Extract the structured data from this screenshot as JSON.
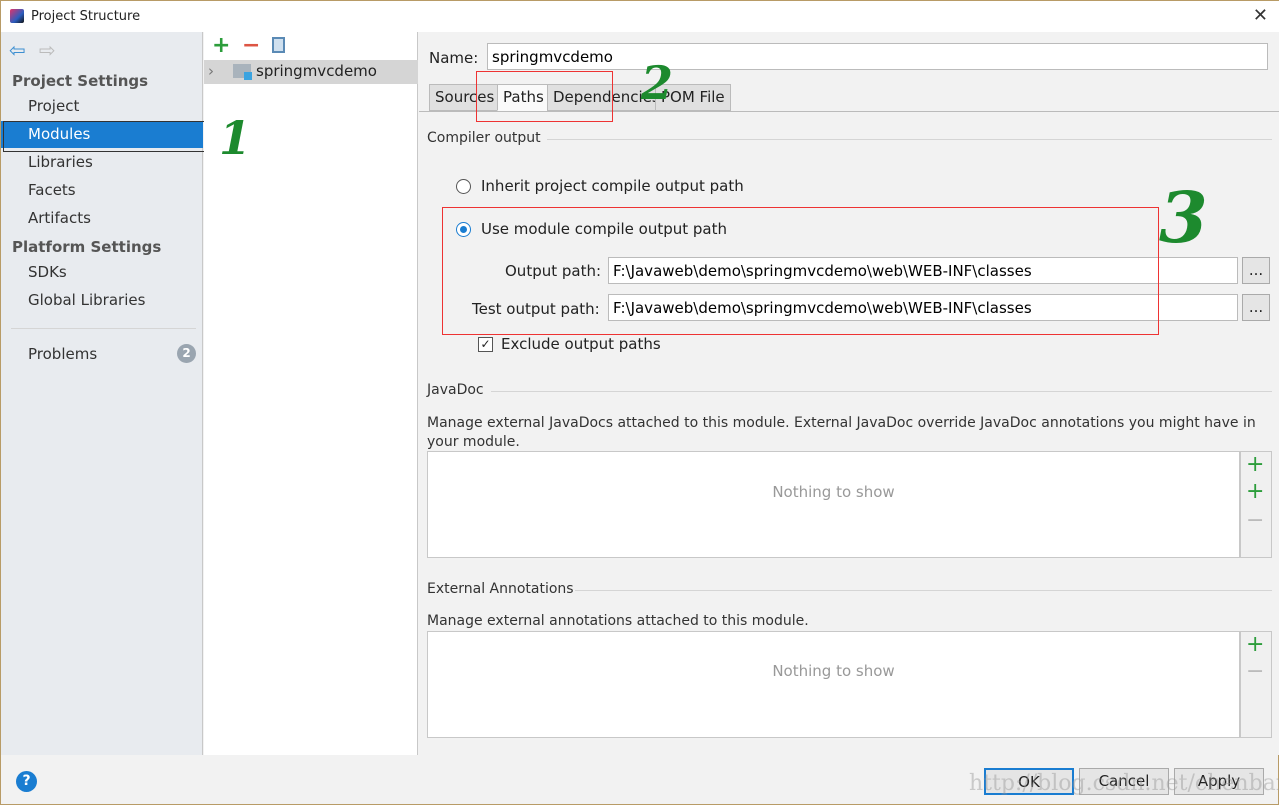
{
  "window": {
    "title": "Project Structure",
    "close": "✕"
  },
  "sidebar": {
    "project_settings": "Project Settings",
    "items": [
      "Project",
      "Modules",
      "Libraries",
      "Facets",
      "Artifacts"
    ],
    "platform_settings": "Platform Settings",
    "platform_items": [
      "SDKs",
      "Global Libraries"
    ],
    "problems": "Problems",
    "problems_count": "2"
  },
  "tree": {
    "module": "springmvcdemo"
  },
  "main": {
    "name_label": "Name:",
    "name_value": "springmvcdemo",
    "tabs": [
      "Sources",
      "Paths",
      "Dependencies",
      "POM File"
    ],
    "active_tab": "Paths",
    "compiler_output": "Compiler output",
    "inherit": "Inherit project compile output path",
    "use_module": "Use module compile output path",
    "selected": "use_module",
    "output_label": "Output path:",
    "output_value": "F:\\Javaweb\\demo\\springmvcdemo\\web\\WEB-INF\\classes",
    "test_label": "Test output path:",
    "test_value": "F:\\Javaweb\\demo\\springmvcdemo\\web\\WEB-INF\\classes",
    "browse": "...",
    "exclude": "Exclude output paths",
    "exclude_checked": true,
    "javadoc": "JavaDoc",
    "javadoc_desc": "Manage external JavaDocs attached to this module. External JavaDoc override JavaDoc annotations you might have in your module.",
    "nothing": "Nothing to show",
    "ext_ann": "External Annotations",
    "ext_desc": "Manage external annotations attached to this module."
  },
  "footer": {
    "help": "?",
    "ok": "OK",
    "cancel": "Cancel",
    "apply": "Apply"
  },
  "annotations": [
    "1",
    "2",
    "3"
  ],
  "watermark": "http://blog.csdn.net/chenbanwa",
  "colors": {
    "accent": "#1a7dd1",
    "annotation_green": "#1d8a2e",
    "annotation_red": "#e33333"
  }
}
